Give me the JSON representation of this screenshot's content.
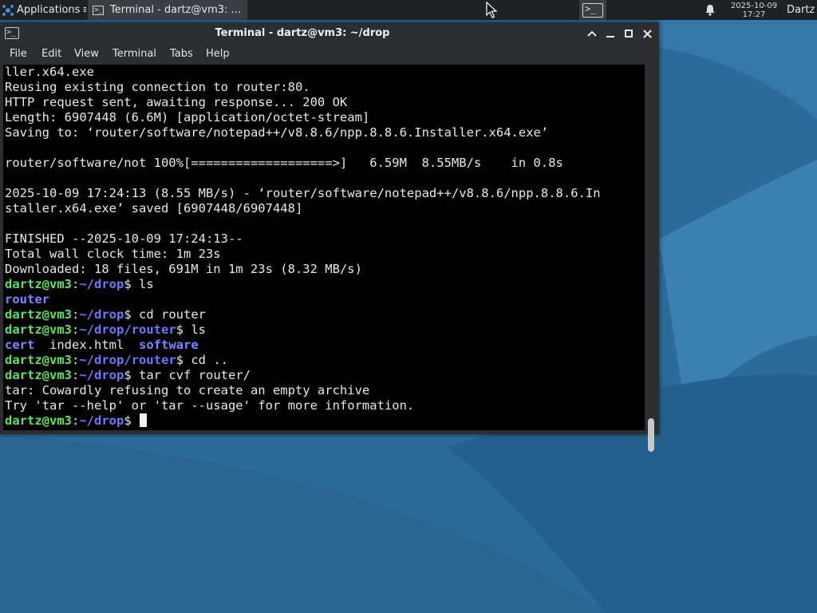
{
  "panel": {
    "applications_label": "Applications",
    "taskbar_terminal_label": "Terminal - dartz@vm3: ...",
    "clock_date": "2025-10-09",
    "clock_time": "17:27",
    "user_label": "Dartz"
  },
  "window": {
    "title": "Terminal - dartz@vm3: ~/drop",
    "menu": [
      "File",
      "Edit",
      "View",
      "Terminal",
      "Tabs",
      "Help"
    ]
  },
  "terminal": {
    "prompt_user": "dartz@vm3",
    "lines": [
      "ller.x64.exe",
      "Reusing existing connection to router:80.",
      "HTTP request sent, awaiting response... 200 OK",
      "Length: 6907448 (6.6M) [application/octet-stream]",
      "Saving to: ‘router/software/notepad++/v8.8.6/npp.8.8.6.Installer.x64.exe’",
      "",
      "router/software/not 100%[===================>]   6.59M  8.55MB/s    in 0.8s",
      "",
      "2025-10-09 17:24:13 (8.55 MB/s) - ‘router/software/notepad++/v8.8.6/npp.8.8.6.In",
      "staller.x64.exe’ saved [6907448/6907448]",
      "",
      "FINISHED --2025-10-09 17:24:13--",
      "Total wall clock time: 1m 23s",
      "Downloaded: 18 files, 691M in 1m 23s (8.32 MB/s)"
    ],
    "session": [
      {
        "path": "~/drop",
        "cmd": "ls"
      },
      {
        "output_dirs": [
          "router"
        ]
      },
      {
        "path": "~/drop",
        "cmd": "cd router"
      },
      {
        "path": "~/drop/router",
        "cmd": "ls"
      },
      {
        "output_listing": [
          {
            "text": "cert",
            "dir": true
          },
          {
            "text": "index.html",
            "dir": false
          },
          {
            "text": "software",
            "dir": true
          }
        ]
      },
      {
        "path": "~/drop/router",
        "cmd": "cd .."
      },
      {
        "path": "~/drop",
        "cmd": "tar cvf router/"
      },
      {
        "text": "tar: Cowardly refusing to create an empty archive"
      },
      {
        "text": "Try 'tar --help' or 'tar --usage' for more information."
      },
      {
        "path": "~/drop",
        "cmd": "",
        "cursor": true
      }
    ]
  },
  "colors": {
    "prompt_user": "#5fe35f",
    "prompt_path": "#6b78ff",
    "directory": "#7b86ff"
  }
}
